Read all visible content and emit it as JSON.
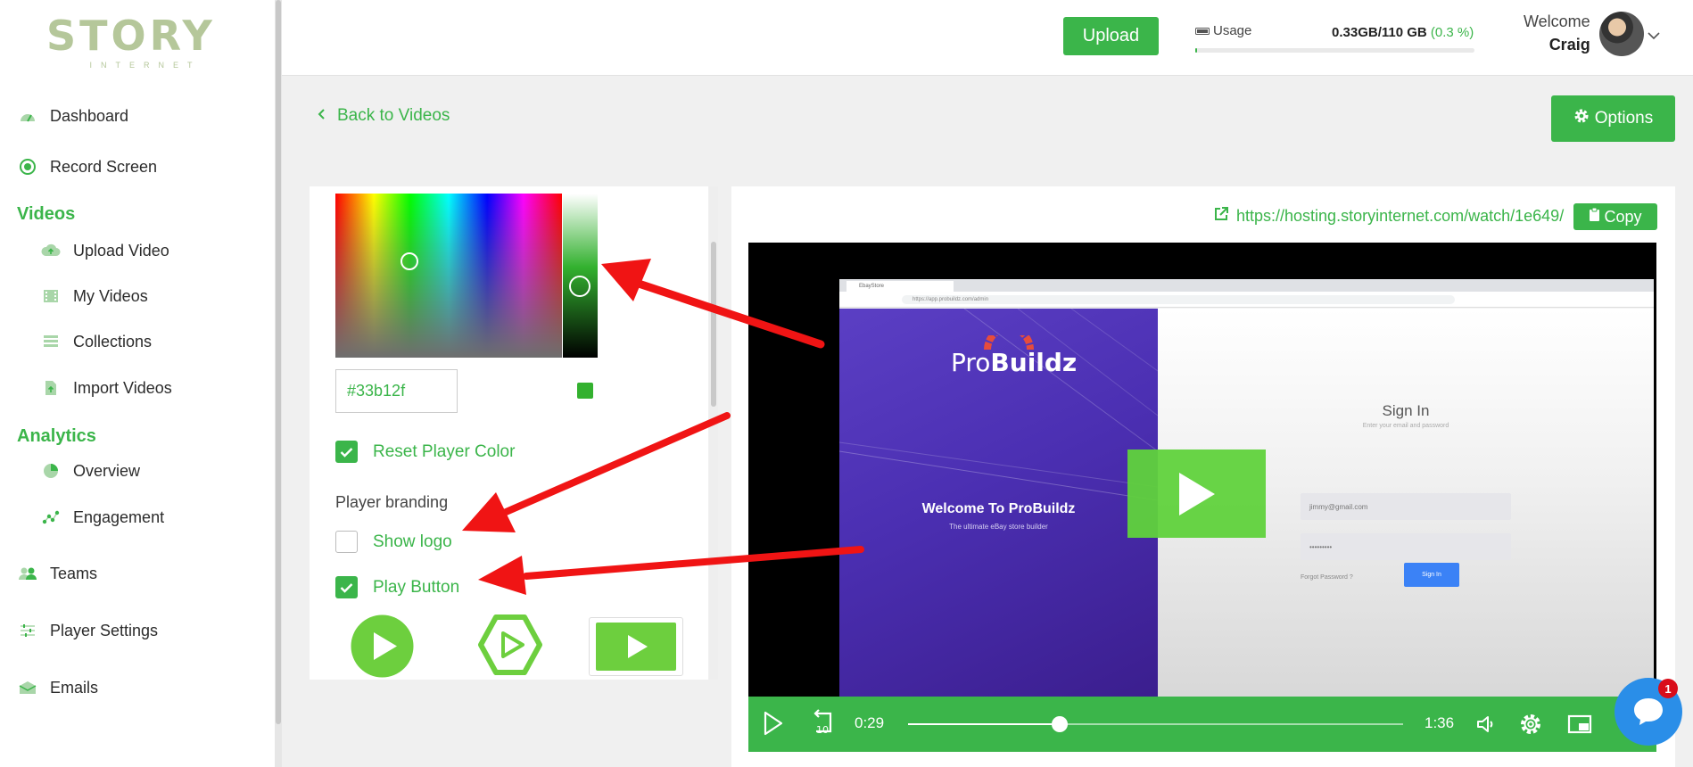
{
  "brand": {
    "word": "STORY",
    "sub": "INTERNET"
  },
  "sidebar": {
    "items": [
      {
        "label": "Dashboard"
      },
      {
        "label": "Record Screen"
      },
      {
        "label": "Upload Video"
      },
      {
        "label": "My Videos"
      },
      {
        "label": "Collections"
      },
      {
        "label": "Import Videos"
      },
      {
        "label": "Overview"
      },
      {
        "label": "Engagement"
      },
      {
        "label": "Teams"
      },
      {
        "label": "Player Settings"
      },
      {
        "label": "Emails"
      }
    ],
    "sections": {
      "videos": "Videos",
      "analytics": "Analytics"
    }
  },
  "header": {
    "upload_label": "Upload",
    "usage_label": "Usage",
    "usage_value": "0.33GB/110 GB",
    "usage_percent": "(0.3 %)",
    "usage_fraction": 0.003,
    "welcome": "Welcome",
    "user_name": "Craig"
  },
  "page": {
    "back_label": "Back to Videos",
    "options_label": "Options"
  },
  "player_settings": {
    "color_hex": "#33b12f",
    "reset_player_color": {
      "label": "Reset Player Color",
      "checked": true
    },
    "branding_heading": "Player branding",
    "show_logo": {
      "label": "Show logo",
      "checked": false
    },
    "play_button": {
      "label": "Play Button",
      "checked": true
    }
  },
  "share": {
    "url": "https://hosting.storyinternet.com/watch/1e649/",
    "copy_label": "Copy"
  },
  "video": {
    "browser_tab": "EbayStore",
    "browser_url": "https://app.probuildz.com/admin",
    "logo_pre": "Pro",
    "logo_bold": "Buildz",
    "welcome_title": "Welcome To ProBuildz",
    "tagline": "The ultimate eBay store builder",
    "signin_title": "Sign In",
    "signin_sub": "Enter your email and password",
    "email_value": "jimmy@gmail.com",
    "password_value": "•••••••••",
    "forgot_label": "Forgot Password ?",
    "signin_button": "Sign In",
    "current_time": "0:29",
    "duration": "1:36",
    "progress_fraction": 0.307
  },
  "chat": {
    "badge": "1"
  },
  "colors": {
    "accent": "#3bb54a",
    "arrow": "#f01414",
    "player": "#33b12f"
  }
}
